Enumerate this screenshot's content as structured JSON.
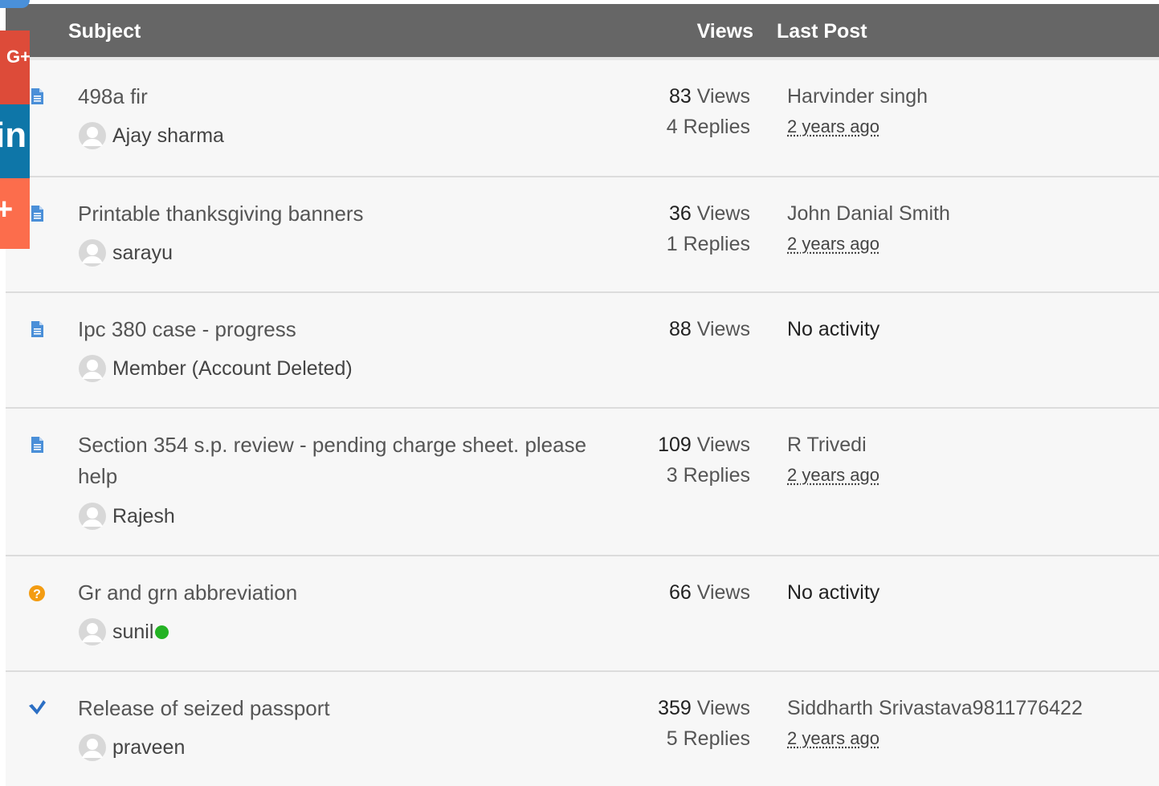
{
  "header": {
    "subject": "Subject",
    "views": "Views",
    "last_post": "Last Post"
  },
  "labels": {
    "views_suffix": "Views",
    "replies_suffix": "Replies"
  },
  "share_bar": {
    "gplus_label": "G+",
    "linkedin_label": "in",
    "addthis_label": "+"
  },
  "rows": [
    {
      "icon": "document-icon",
      "title": "498a fir",
      "author": "Ajay sharma",
      "views": "83",
      "replies": "4",
      "last_user": "Harvinder singh",
      "last_time": "2 years ago"
    },
    {
      "icon": "document-icon",
      "title": "Printable thanksgiving banners",
      "author": "sarayu",
      "views": "36",
      "replies": "1",
      "last_user": "John Danial Smith",
      "last_time": "2 years ago"
    },
    {
      "icon": "document-icon",
      "title": "Ipc 380 case - progress",
      "author": "Member (Account Deleted)",
      "views": "88",
      "last_activity": "No activity"
    },
    {
      "icon": "document-icon",
      "title": "Section 354 s.p. review - pending charge sheet. please help",
      "author": "Rajesh",
      "views": "109",
      "replies": "3",
      "last_user": "R Trivedi",
      "last_time": "2 years ago"
    },
    {
      "icon": "question-icon",
      "title": "Gr and grn abbreviation",
      "author": "sunil",
      "online": true,
      "views": "66",
      "last_activity": "No activity"
    },
    {
      "icon": "resolved-check-icon",
      "title": "Release of seized passport",
      "author": "praveen",
      "views": "359",
      "replies": "5",
      "last_user": "Siddharth Srivastava9811776422",
      "last_time": "2 years ago"
    }
  ]
}
